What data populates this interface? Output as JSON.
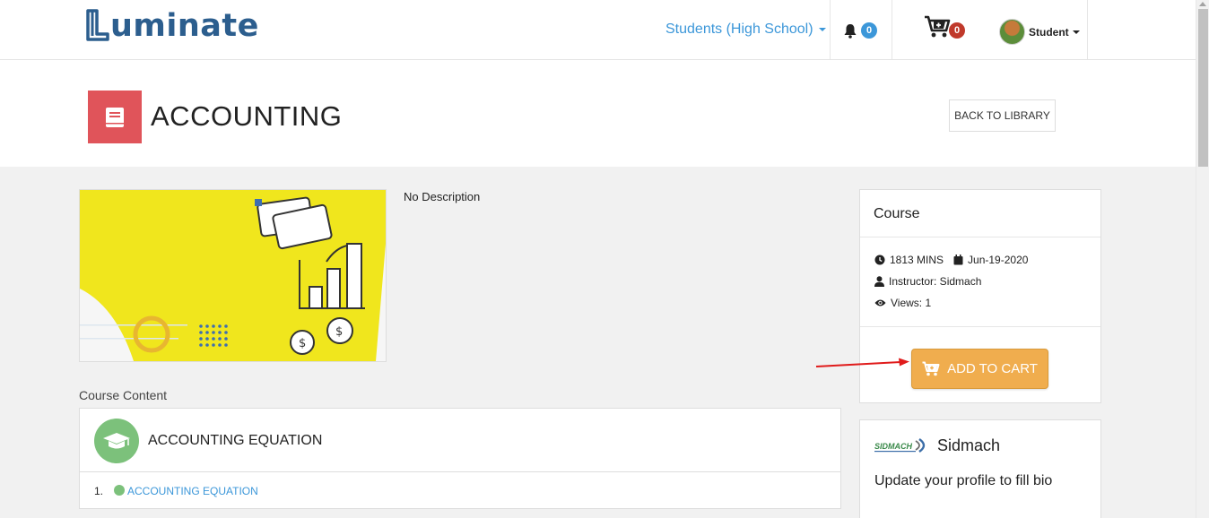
{
  "brand": {
    "logo_text": "uminate"
  },
  "nav": {
    "role_label": "Students (High School)",
    "notifications_count": "0",
    "cart_count": "0",
    "user_label": "Student"
  },
  "header": {
    "title": "ACCOUNTING",
    "back_button": "BACK TO LIBRARY"
  },
  "course": {
    "description": "No Description",
    "content_label": "Course Content",
    "chapters": [
      {
        "title": "ACCOUNTING EQUATION",
        "lessons": [
          {
            "number": "1.",
            "title": "ACCOUNTING EQUATION"
          }
        ]
      }
    ]
  },
  "sidebar": {
    "card_title": "Course",
    "duration": "1813 MINS",
    "date": "Jun-19-2020",
    "instructor": "Instructor: Sidmach",
    "views": "Views: 1",
    "add_to_cart": "ADD TO CART"
  },
  "instructor_card": {
    "name": "Sidmach",
    "bio": "Update your profile to fill bio",
    "logo_text": "SIDMACH"
  },
  "colors": {
    "accent_blue": "#3c97d9",
    "title_red": "#e0545a",
    "cart_orange": "#f0ad4e",
    "chapter_green": "#7cc17b",
    "brand_navy": "#2c5e8e"
  }
}
